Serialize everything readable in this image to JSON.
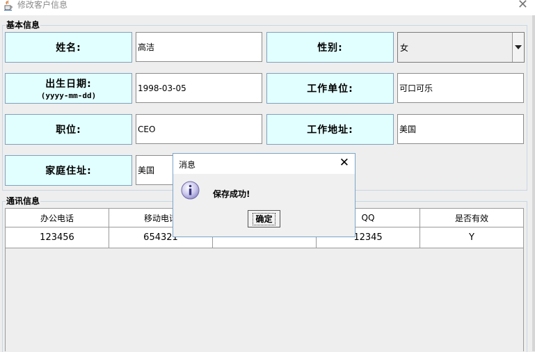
{
  "window": {
    "title": "修改客户信息",
    "icon": "java-cup-icon",
    "close_glyph": "✕"
  },
  "basic_info": {
    "title": "基本信息",
    "name_label": "姓名:",
    "name_value": "高洁",
    "gender_label": "性别:",
    "gender_value": "女",
    "birth_label": "出生日期:",
    "birth_format": "(yyyy-mm-dd)",
    "birth_value": "1998-03-05",
    "employer_label": "工作单位:",
    "employer_value": "可口可乐",
    "position_label": "职位:",
    "position_value": "CEO",
    "work_address_label": "工作地址:",
    "work_address_value": "美国",
    "home_address_label": "家庭住址:",
    "home_address_value": "美国"
  },
  "contact_info": {
    "title": "通讯信息",
    "columns": [
      "办公电话",
      "移动电话",
      "",
      "QQ",
      "是否有效"
    ],
    "rows": [
      [
        "123456",
        "654321",
        "",
        "12345",
        "Y"
      ]
    ]
  },
  "dialog": {
    "title": "消息",
    "message": "保存成功!",
    "ok_label": "确定",
    "close_glyph": "✕",
    "icon": "info-icon"
  },
  "colors": {
    "label_bg": "#e2ffff",
    "label_border": "#7fa0bd",
    "dialog_border": "#7aa4c9",
    "window_bg": "#eeeeee"
  }
}
